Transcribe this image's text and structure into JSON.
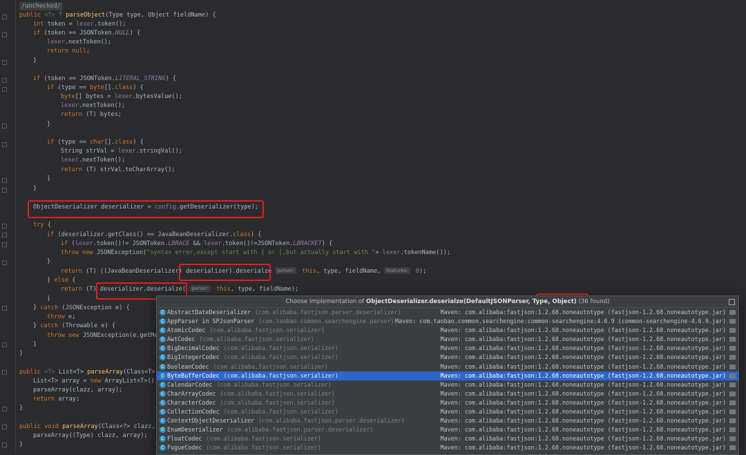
{
  "code": {
    "annotation": "/unchecked/",
    "lines": {
      "l1": [
        "public ",
        "<T> ",
        "T ",
        "parseObject",
        "(Type type, Object fieldName) {"
      ],
      "l2": [
        "int ",
        "token = ",
        "lexer",
        ".token();"
      ],
      "l3": [
        "if ",
        "(token == JSONToken.",
        "NULL",
        ") {"
      ],
      "l4": [
        "lexer",
        ".nextToken();"
      ],
      "l5": [
        "return null",
        ";"
      ],
      "l6": "}",
      "l7": [
        "if ",
        "(token == JSONToken.",
        "LITERAL_STRING",
        ") {"
      ],
      "l8": [
        "if ",
        "(type == ",
        "byte",
        "[].",
        "class",
        ") {"
      ],
      "l9": [
        "byte",
        "[] bytes = ",
        "lexer",
        ".bytesValue();"
      ],
      "l10": [
        "lexer",
        ".nextToken();"
      ],
      "l11": [
        "return ",
        "(T) bytes;"
      ],
      "l12": "}",
      "l13": [
        "if ",
        "(type == ",
        "char",
        "[].",
        "class",
        ") {"
      ],
      "l14": [
        "String strVal = ",
        "lexer",
        ".stringVal();"
      ],
      "l15": [
        "lexer",
        ".nextToken();"
      ],
      "l16": [
        "return ",
        "(T) strVal.toCharArray();"
      ],
      "l17": "}",
      "l18": "}",
      "l19": [
        "ObjectDeserializer deserializer = ",
        "config",
        ".getDeserializer(type);"
      ],
      "l20": [
        "try ",
        "{"
      ],
      "l21": [
        "if ",
        "(deserializer.getClass() == JavaBeanDeserializer.",
        "class",
        ") {"
      ],
      "l22": [
        "if ",
        "(",
        "lexer",
        ".token()!= JSONToken.",
        "LBRACE ",
        "&& ",
        "lexer",
        ".token()!=JSONToken.",
        "LBRACKET",
        ") {"
      ],
      "l23": [
        "throw new ",
        "JSONException(",
        "\"syntax error,except start with { or [,but actually start with \"",
        "+ ",
        "lexer",
        ".tokenName());"
      ],
      "l24": "}",
      "l25": [
        "return ",
        "(T) ((JavaBeanDeserializer) ",
        "deserializer).deserialze",
        "parser:",
        " this",
        ", type, fieldName, ",
        "features:",
        " 0",
        ");"
      ],
      "l26": [
        "} ",
        "else ",
        "{"
      ],
      "l27": [
        "return ",
        "(T) ",
        "deserializer.deserialze(",
        "parser:",
        " this",
        ", type, fieldName);"
      ],
      "l28": "}",
      "l29": [
        "} ",
        "catch ",
        "(JSONException e) {"
      ],
      "l30": [
        "throw ",
        "e;"
      ],
      "l31": [
        "} ",
        "catch ",
        "(Throwable e) {"
      ],
      "l32": [
        "throw new ",
        "JSONException(e.getMe"
      ],
      "l33": "}",
      "l34": "}",
      "l35": [
        "public ",
        "<T> ",
        "List<T> ",
        "parseArray",
        "(Class<T>"
      ],
      "l36": [
        "List<T> array = ",
        "new ",
        "ArrayList<T>();"
      ],
      "l37": "parseArray(clazz, array);",
      "l38": [
        "return ",
        "array;"
      ],
      "l39": "}",
      "l40": [
        "public void ",
        "parseArray",
        "(Class<?> clazz,"
      ],
      "l41": "parseArray((Type) clazz, array);",
      "l42": "}"
    }
  },
  "popup": {
    "title_prefix": "Choose Implementation of ",
    "title_method": "ObjectDeserializer.deserialze(DefaultJSONParser, Type, Object)",
    "title_count": " (36 found)",
    "items": [
      {
        "name": "AbstractDateDeserializer",
        "pkg": "(com.alibaba.fastjson.parser.deserializer)",
        "maven": "Maven: com.alibaba:fastjson:1.2.68.noneautotype (fastjson-1.2.68.noneautotype.jar)"
      },
      {
        "name": "AppParser in SPJsonParser",
        "pkg": "(com.taobao.common.searchengine.parser)",
        "maven": "Maven: com.taobao.common.searchengine:common-searchengine:4.6.9 (common-searchengine-4.6.9.jar)"
      },
      {
        "name": "AtomicCodec",
        "pkg": "(com.alibaba.fastjson.serializer)",
        "maven": "Maven: com.alibaba:fastjson:1.2.68.noneautotype (fastjson-1.2.68.noneautotype.jar)"
      },
      {
        "name": "AwtCodec",
        "pkg": "(com.alibaba.fastjson.serializer)",
        "maven": "Maven: com.alibaba:fastjson:1.2.68.noneautotype (fastjson-1.2.68.noneautotype.jar)"
      },
      {
        "name": "BigDecimalCodec",
        "pkg": "(com.alibaba.fastjson.serializer)",
        "maven": "Maven: com.alibaba:fastjson:1.2.68.noneautotype (fastjson-1.2.68.noneautotype.jar)"
      },
      {
        "name": "BigIntegerCodec",
        "pkg": "(com.alibaba.fastjson.serializer)",
        "maven": "Maven: com.alibaba:fastjson:1.2.68.noneautotype (fastjson-1.2.68.noneautotype.jar)"
      },
      {
        "name": "BooleanCodec",
        "pkg": "(com.alibaba.fastjson.serializer)",
        "maven": "Maven: com.alibaba:fastjson:1.2.68.noneautotype (fastjson-1.2.68.noneautotype.jar)"
      },
      {
        "name": "ByteBufferCodec",
        "pkg": "(com.alibaba.fastjson.serializer)",
        "maven": "Maven: com.alibaba:fastjson:1.2.68.noneautotype (fastjson-1.2.68.noneautotype.jar)",
        "selected": true
      },
      {
        "name": "CalendarCodec",
        "pkg": "(com.alibaba.fastjson.serializer)",
        "maven": "Maven: com.alibaba:fastjson:1.2.68.noneautotype (fastjson-1.2.68.noneautotype.jar)"
      },
      {
        "name": "CharArrayCodec",
        "pkg": "(com.alibaba.fastjson.serializer)",
        "maven": "Maven: com.alibaba:fastjson:1.2.68.noneautotype (fastjson-1.2.68.noneautotype.jar)"
      },
      {
        "name": "CharacterCodec",
        "pkg": "(com.alibaba.fastjson.serializer)",
        "maven": "Maven: com.alibaba:fastjson:1.2.68.noneautotype (fastjson-1.2.68.noneautotype.jar)"
      },
      {
        "name": "CollectionCodec",
        "pkg": "(com.alibaba.fastjson.serializer)",
        "maven": "Maven: com.alibaba:fastjson:1.2.68.noneautotype (fastjson-1.2.68.noneautotype.jar)"
      },
      {
        "name": "ContextObjectDeserializer",
        "pkg": "(com.alibaba.fastjson.parser.deserializer)",
        "maven": "Maven: com.alibaba:fastjson:1.2.68.noneautotype (fastjson-1.2.68.noneautotype.jar)"
      },
      {
        "name": "EnumDeserializer",
        "pkg": "(com.alibaba.fastjson.parser.deserializer)",
        "maven": "Maven: com.alibaba:fastjson:1.2.68.noneautotype (fastjson-1.2.68.noneautotype.jar)"
      },
      {
        "name": "FloatCodec",
        "pkg": "(com.alibaba.fastjson.serializer)",
        "maven": "Maven: com.alibaba:fastjson:1.2.68.noneautotype (fastjson-1.2.68.noneautotype.jar)"
      },
      {
        "name": "FugueCodec",
        "pkg": "(com.alibaba.fastjson.serializer)",
        "maven": "Maven: com.alibaba:fastjson:1.2.68.noneautotype (fastjson-1.2.68.noneautotype.jar)"
      }
    ]
  },
  "colors": {
    "background": "#2b2b2d",
    "keyword": "#cc7832",
    "method": "#ffc66d",
    "field": "#9876aa",
    "string": "#6a8759",
    "highlight_box": "#e02020",
    "selection": "#2f65ca"
  },
  "icons": {
    "class_icon": "class-c-icon",
    "jar_icon": "jar-library-icon",
    "pin_icon": "pin-popup-icon"
  }
}
